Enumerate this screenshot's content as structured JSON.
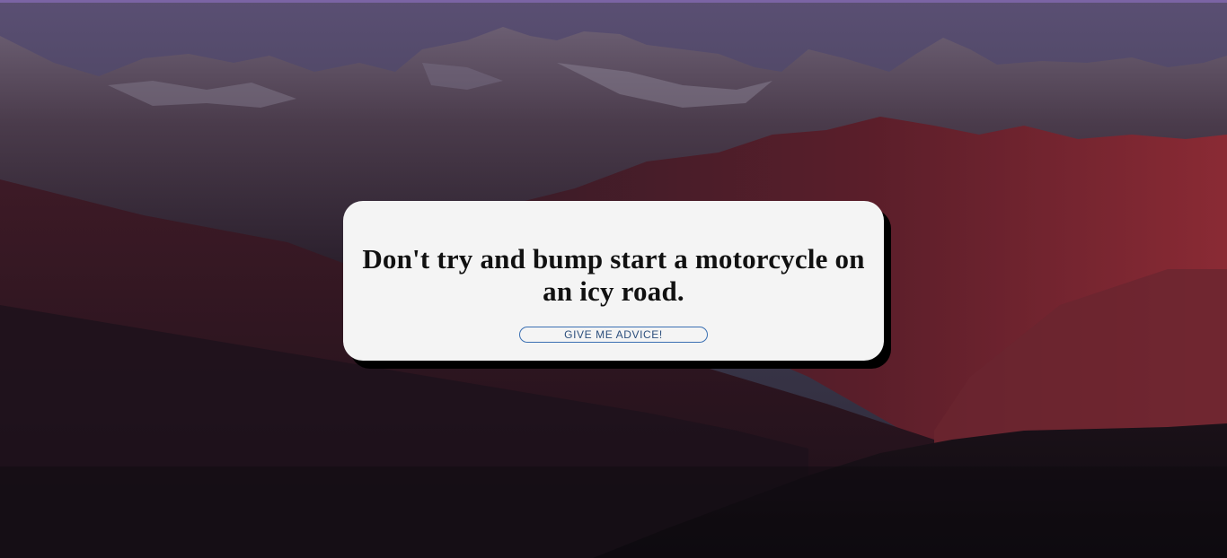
{
  "advice": {
    "text": "Don't try and bump start a motorcycle on an icy road."
  },
  "button": {
    "label": "GIVE ME ADVICE!"
  },
  "colors": {
    "card_background": "#f4f4f4",
    "card_shadow": "#000000",
    "button_border": "#3a6fb2",
    "button_text": "#2c4f7d",
    "sky": "#4a4a62",
    "mountain_red": "#7a2330",
    "dark_ground": "#120d14"
  }
}
